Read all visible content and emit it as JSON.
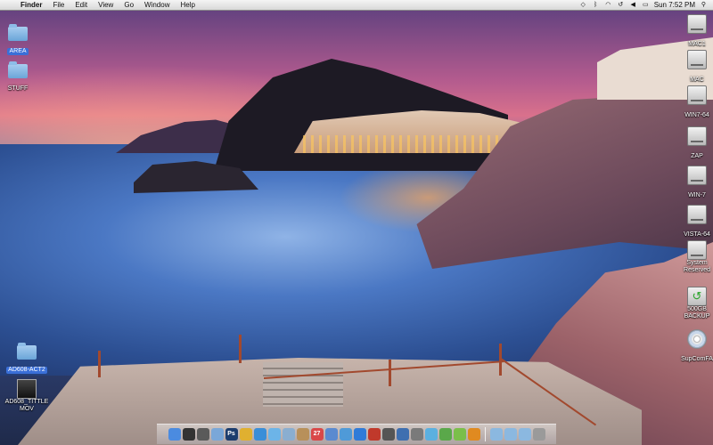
{
  "menubar": {
    "apple": "",
    "app_name": "Finder",
    "items": [
      "File",
      "Edit",
      "View",
      "Go",
      "Window",
      "Help"
    ],
    "clock": "Sun 7:52 PM",
    "status_icons": [
      "dropbox-icon",
      "bluetooth-icon",
      "wifi-icon",
      "time-machine-icon",
      "volume-icon",
      "battery-icon",
      "spotlight-icon"
    ]
  },
  "desktop_left": [
    {
      "label": "AREA",
      "icon": "folder-icon",
      "selected": true
    },
    {
      "label": "STUFF",
      "icon": "folder-icon",
      "selected": false
    },
    {
      "label": "AD608-ACT2",
      "icon": "folder-icon",
      "selected": true
    },
    {
      "label": "AD608_TITTLE\nMOV",
      "icon": "movie-file-icon",
      "selected": false
    }
  ],
  "desktop_right": [
    {
      "label": "MAC1",
      "icon": "hard-drive-icon"
    },
    {
      "label": "MAC",
      "icon": "hard-drive-icon"
    },
    {
      "label": "WIN7-64",
      "icon": "hard-drive-icon"
    },
    {
      "label": "ZAP",
      "icon": "hard-drive-icon"
    },
    {
      "label": "WIN-7",
      "icon": "hard-drive-icon"
    },
    {
      "label": "VISTA-64",
      "icon": "hard-drive-icon"
    },
    {
      "label": "System\nReserved",
      "icon": "hard-drive-icon"
    },
    {
      "label": "500GB\nBACKUP",
      "icon": "time-machine-drive-icon"
    },
    {
      "label": "SupComFA",
      "icon": "optical-disc-icon"
    }
  ],
  "dock": {
    "items": [
      {
        "name": "finder",
        "glyph": "",
        "color": "#4b8be0"
      },
      {
        "name": "dashboard",
        "glyph": "",
        "color": "#333333"
      },
      {
        "name": "mission-control",
        "glyph": "",
        "color": "#5a5a5a"
      },
      {
        "name": "preview",
        "glyph": "",
        "color": "#7aa7d8"
      },
      {
        "name": "photoshop",
        "glyph": "Ps",
        "color": "#1c3d6e"
      },
      {
        "name": "chrome",
        "glyph": "",
        "color": "#e0b030"
      },
      {
        "name": "safari",
        "glyph": "",
        "color": "#3a8ed8"
      },
      {
        "name": "ichat",
        "glyph": "",
        "color": "#6cb4e8"
      },
      {
        "name": "mail",
        "glyph": "",
        "color": "#8aaed0"
      },
      {
        "name": "address-book",
        "glyph": "",
        "color": "#b8905a"
      },
      {
        "name": "ical",
        "glyph": "27",
        "color": "#d94848"
      },
      {
        "name": "iphoto",
        "glyph": "",
        "color": "#5a8ad0"
      },
      {
        "name": "itunes",
        "glyph": "",
        "color": "#4f9ad8"
      },
      {
        "name": "app-store",
        "glyph": "",
        "color": "#2f7bd8"
      },
      {
        "name": "filezilla",
        "glyph": "",
        "color": "#c0392b"
      },
      {
        "name": "camera",
        "glyph": "",
        "color": "#555555"
      },
      {
        "name": "xcode",
        "glyph": "",
        "color": "#3e6fb0"
      },
      {
        "name": "utility",
        "glyph": "",
        "color": "#7a7a7a"
      },
      {
        "name": "network",
        "glyph": "",
        "color": "#5bb0e0"
      },
      {
        "name": "vlc",
        "glyph": "",
        "color": "#5aa84a"
      },
      {
        "name": "transmission",
        "glyph": "",
        "color": "#7bbf4a"
      },
      {
        "name": "system-preferences",
        "glyph": "",
        "color": "#e08a20"
      },
      {
        "name": "applications-folder",
        "glyph": "",
        "color": "#8bb8e0"
      },
      {
        "name": "documents-folder",
        "glyph": "",
        "color": "#8bb8e0"
      },
      {
        "name": "downloads-folder",
        "glyph": "",
        "color": "#8bb8e0"
      },
      {
        "name": "trash",
        "glyph": "",
        "color": "#9a9a9a"
      }
    ]
  }
}
